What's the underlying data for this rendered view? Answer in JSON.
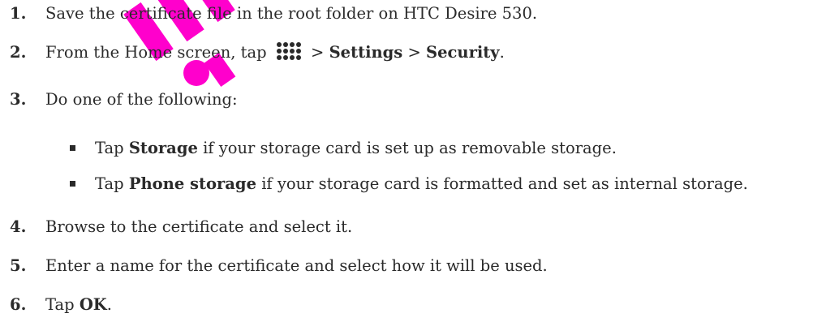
{
  "steps": [
    {
      "num": "1.",
      "text": "Save the certificate file in the root folder on HTC Desire 530."
    },
    {
      "num": "2.",
      "pre": "From the Home screen, tap",
      "icon": "apps-grid-icon",
      "sep1": ">",
      "b1": "Settings",
      "sep2": ">",
      "b2": "Security",
      "end": "."
    },
    {
      "num": "3.",
      "text": "Do one of the following:"
    },
    {
      "num": "4.",
      "text": "Browse to the certificate and select it."
    },
    {
      "num": "5.",
      "text": "Enter a name for the certificate and select how it will be used."
    },
    {
      "num": "6.",
      "pre": "Tap",
      "b1": "OK",
      "end": "."
    }
  ],
  "bullets": [
    {
      "pre": "Tap",
      "bold": "Storage",
      "post": "if your storage card is set up as removable storage."
    },
    {
      "pre": "Tap",
      "bold": "Phone storage",
      "post": "if your storage card is formatted and set as internal storage."
    }
  ],
  "colors": {
    "text": "#2a2a2a",
    "watermark": "#ff00cc"
  }
}
